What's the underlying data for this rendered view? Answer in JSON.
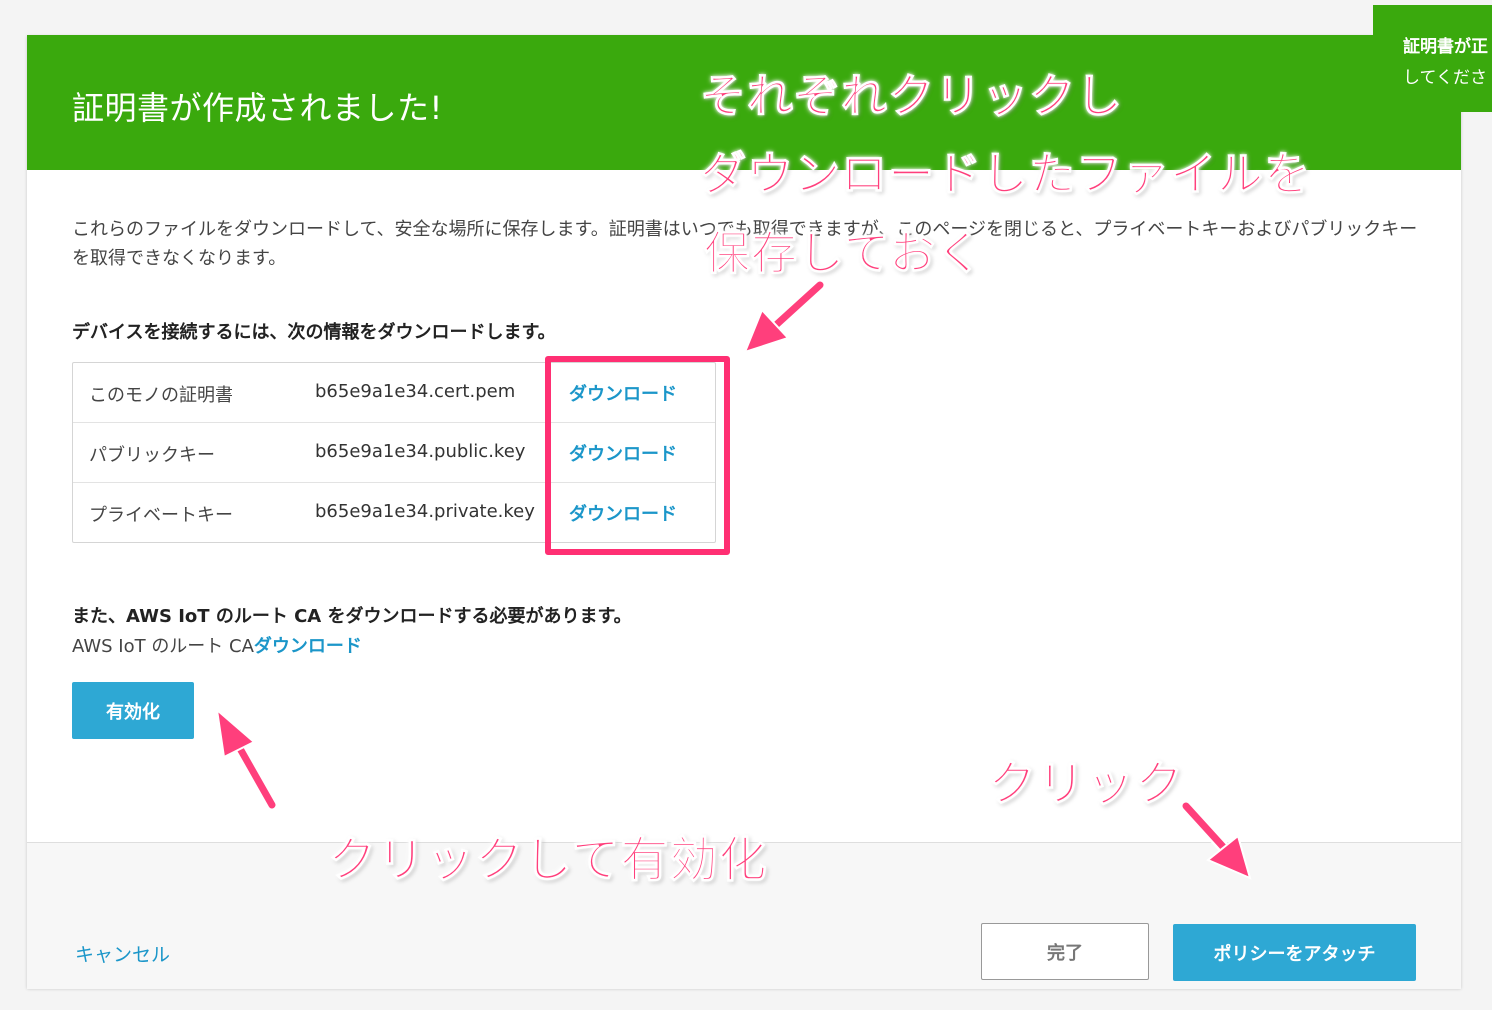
{
  "header": {
    "title": "証明書が作成されました!"
  },
  "toast": {
    "line1": "証明書が正",
    "line2": "してくださ"
  },
  "intro_text": "これらのファイルをダウンロードして、安全な場所に保存します。証明書はいつでも取得できますが、このページを閉じると、プライベートキーおよびパブリックキーを取得できなくなります。",
  "section_title": "デバイスを接続するには、次の情報をダウンロードします。",
  "files": [
    {
      "label": "このモノの証明書",
      "filename": "b65e9a1e34.cert.pem",
      "link": "ダウンロード"
    },
    {
      "label": "パブリックキー",
      "filename": "b65e9a1e34.public.key",
      "link": "ダウンロード"
    },
    {
      "label": "プライベートキー",
      "filename": "b65e9a1e34.private.key",
      "link": "ダウンロード"
    }
  ],
  "root_ca": {
    "title": "また、AWS IoT のルート CA をダウンロードする必要があります。",
    "prefix": "AWS IoT のルート CA",
    "link": "ダウンロード"
  },
  "activate_button": "有効化",
  "footer": {
    "cancel": "キャンセル",
    "done": "完了",
    "attach_policy": "ポリシーをアタッチ"
  },
  "annotations": {
    "download_note_1": "それぞれクリックし",
    "download_note_2": "ダウンロードしたファイルを",
    "download_note_3": "保存しておく",
    "activate_note": "クリックして有効化",
    "attach_note": "クリック",
    "color": "#ff3f7c"
  }
}
